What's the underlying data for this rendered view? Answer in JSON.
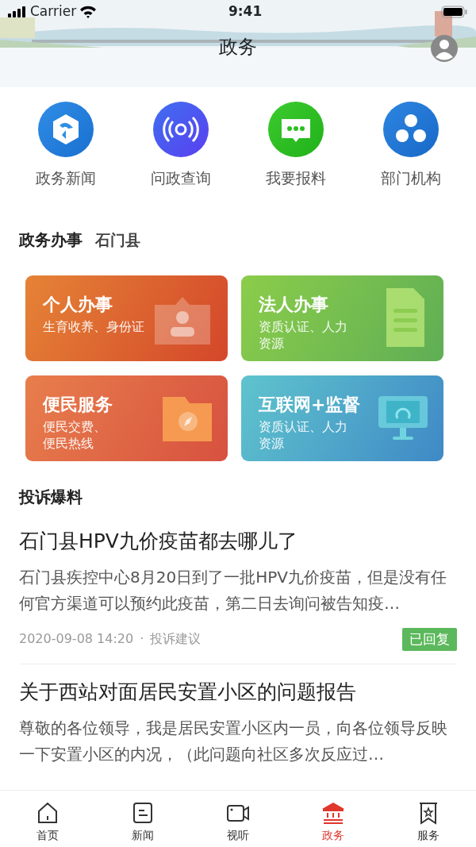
{
  "status_bar": {
    "carrier": "Carrier",
    "time": "9:41"
  },
  "header": {
    "title": "政务"
  },
  "quick_links": [
    {
      "label": "政务新闻",
      "kind": "hexagon"
    },
    {
      "label": "问政查询",
      "kind": "signal"
    },
    {
      "label": "我要报料",
      "kind": "chat"
    },
    {
      "label": "部门机构",
      "kind": "org"
    }
  ],
  "services": {
    "title": "政务办事",
    "region": "石门县",
    "cards": [
      {
        "title": "个人办事",
        "subtitle": "生育收养、身份证",
        "kind": "person"
      },
      {
        "title": "法人办事",
        "subtitle": "资质认证、人力资源",
        "kind": "document"
      },
      {
        "title": "便民服务",
        "subtitle": "便民交费、便民热线",
        "kind": "folder"
      },
      {
        "title": "互联网+监督",
        "subtitle": "资质认证、人力资源",
        "kind": "monitor"
      }
    ]
  },
  "complaints": {
    "title": "投诉爆料",
    "items": [
      {
        "title": "石门县HPV九价疫苗都去哪儿了",
        "summary": "石门县疾控中心8月20日到了一批HPV九价疫苗，但是没有任何官方渠道可以预约此疫苗，第二日去询问被告知疫…",
        "time": "2020-09-08 14:20",
        "separator": "·",
        "category": "投诉建议",
        "badge": "已回复"
      },
      {
        "title": "关于西站对面居民安置小区的问题报告",
        "summary": "尊敬的各位领导，我是居民安置小区内一员，向各位领导反映一下安置小区的内况，（此问题向社区多次反应过…"
      }
    ]
  },
  "tab_bar": [
    {
      "label": "首页",
      "kind": "home",
      "selected": false
    },
    {
      "label": "新闻",
      "kind": "news",
      "selected": false
    },
    {
      "label": "视听",
      "kind": "video",
      "selected": false
    },
    {
      "label": "政务",
      "kind": "gov",
      "selected": true
    },
    {
      "label": "服务",
      "kind": "bookmark",
      "selected": false
    }
  ]
}
